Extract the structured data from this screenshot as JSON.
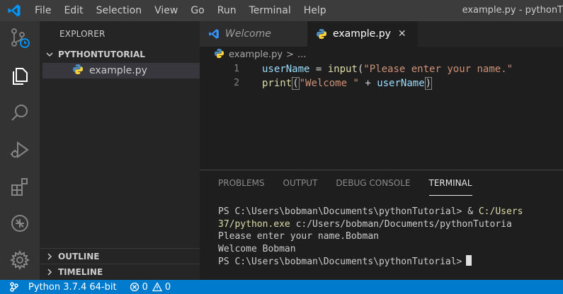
{
  "window_title": "example.py - pythonT",
  "menu": [
    "File",
    "Edit",
    "Selection",
    "View",
    "Go",
    "Run",
    "Terminal",
    "Help"
  ],
  "sidebar": {
    "title": "EXPLORER",
    "folder": "PYTHONTUTORIAL",
    "files": [
      "example.py"
    ],
    "sections": [
      "OUTLINE",
      "TIMELINE"
    ]
  },
  "tabs": [
    {
      "label": "Welcome",
      "active": false
    },
    {
      "label": "example.py",
      "active": true,
      "close": "✕"
    }
  ],
  "breadcrumb": {
    "file": "example.py",
    "separator": ">",
    "more": "..."
  },
  "editor": {
    "lines": [
      {
        "num": "1",
        "tokens": [
          "userName",
          " = ",
          "input",
          "(",
          "\"Please enter your name.\""
        ]
      },
      {
        "num": "2",
        "tokens": [
          "print",
          "(",
          "\"Welcome \"",
          " + ",
          "userName",
          ")"
        ]
      }
    ]
  },
  "panel": {
    "tabs": [
      "PROBLEMS",
      "OUTPUT",
      "DEBUG CONSOLE",
      "TERMINAL"
    ],
    "active_tab": "TERMINAL",
    "terminal_lines": [
      {
        "prefix": "PS C:\\Users\\bobman\\Documents\\pythonTutorial> & ",
        "highlight": "C:/Users"
      },
      {
        "prefix": "",
        "highlight": "37/python.exe",
        "rest": " c:/Users/bobman/Documents/pythonTutoria"
      },
      {
        "prefix": "Please enter your name.Bobman"
      },
      {
        "prefix": "Welcome Bobman"
      },
      {
        "prefix": "PS C:\\Users\\bobman\\Documents\\pythonTutorial>"
      }
    ]
  },
  "status": {
    "python": "Python 3.7.4 64-bit",
    "errors": "0",
    "warnings": "0"
  },
  "colors": {
    "accent": "#007acc",
    "activity_bar": "#333333",
    "sidebar": "#252526",
    "editor": "#1e1e1e"
  }
}
